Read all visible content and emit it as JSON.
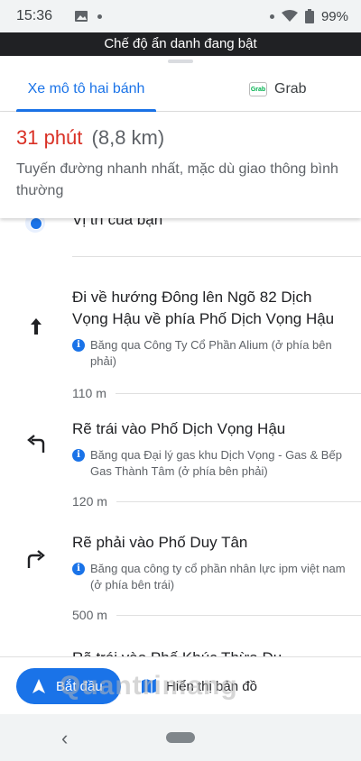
{
  "status_bar": {
    "time": "15:36",
    "battery": "99%"
  },
  "incognito_banner": "Chế độ ẩn danh đang bật",
  "tabs": [
    {
      "label": "Xe mô tô hai bánh",
      "active": true
    },
    {
      "label": "Grab",
      "logo_text": "Grab",
      "active": false
    }
  ],
  "summary": {
    "duration": "31 phút",
    "distance": "(8,8 km)",
    "description": "Tuyến đường nhanh nhất, mặc dù giao thông bình thường"
  },
  "origin": {
    "label": "Vị trí của bạn"
  },
  "steps": [
    {
      "icon": "arrow-up-icon",
      "title": "Đi về hướng Đông lên Ngõ 82 Dịch Vọng Hậu về phía Phố Dịch Vọng Hậu",
      "note": "Băng qua Công Ty Cổ Phần Alium (ở phía bên phải)",
      "distance": "110 m"
    },
    {
      "icon": "turn-left-icon",
      "title": "Rẽ trái vào Phố Dịch Vọng Hậu",
      "note": "Băng qua Đại lý gas khu Dịch Vọng - Gas & Bếp Gas Thành Tâm (ở phía bên phải)",
      "distance": "120 m"
    },
    {
      "icon": "turn-right-icon",
      "title": "Rẽ phải vào Phố Duy Tân",
      "note": "Băng qua công ty cổ phần nhân lực ipm việt nam (ở phía bên trái)",
      "distance": "500 m"
    },
    {
      "icon": "turn-left-icon",
      "title": "Rẽ trái vào Phố Khúc Thừa Dụ"
    }
  ],
  "actions": {
    "start": "Bắt đầu",
    "show_map": "Hiển thị bản đồ"
  },
  "watermark": "Quantrimang",
  "colors": {
    "accent": "#1a73e8",
    "duration": "#d93025",
    "incognito_bg": "#202124"
  }
}
